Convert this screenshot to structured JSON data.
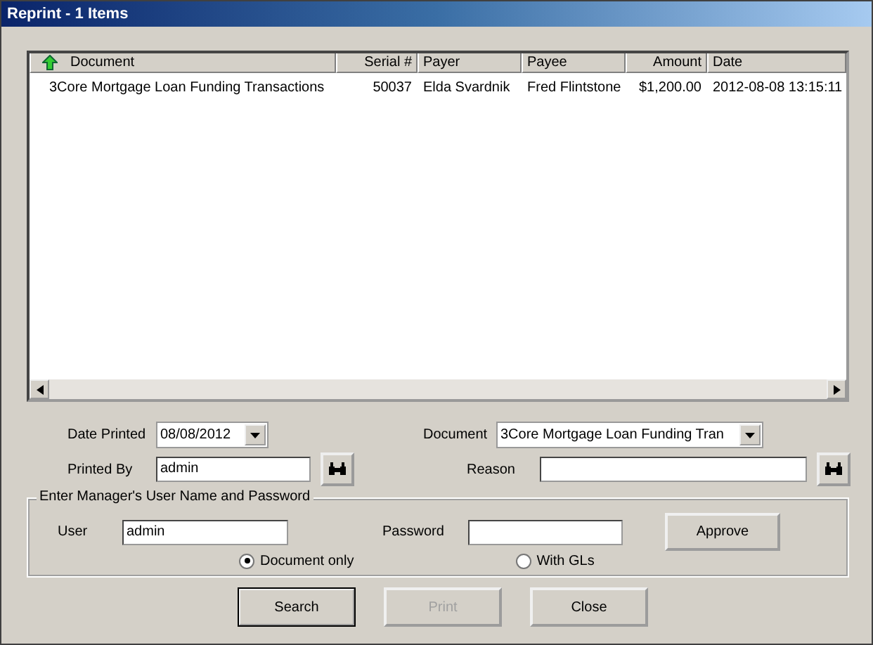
{
  "window": {
    "title": "Reprint - 1 Items"
  },
  "table": {
    "columns": [
      {
        "label": "Document",
        "sorted": true
      },
      {
        "label": "Serial #",
        "sorted": false
      },
      {
        "label": "Payer",
        "sorted": false
      },
      {
        "label": "Payee",
        "sorted": false
      },
      {
        "label": "Amount",
        "sorted": false
      },
      {
        "label": "Date",
        "sorted": false
      }
    ],
    "rows": [
      [
        "3Core Mortgage Loan Funding Transactions",
        "50037",
        "Elda Svardnik",
        "Fred Flintstone",
        "$1,200.00",
        "2012-08-08 13:15:11"
      ]
    ]
  },
  "filters": {
    "date_printed": {
      "label": "Date Printed",
      "value": "08/08/2012"
    },
    "document": {
      "label": "Document",
      "value": "3Core Mortgage Loan Funding Tran"
    },
    "printed_by": {
      "label": "Printed By",
      "value": "admin"
    },
    "reason": {
      "label": "Reason"
    }
  },
  "approval": {
    "title": "Enter Manager's User Name and Password",
    "user": {
      "label": "User",
      "value": "admin"
    },
    "password": {
      "label": "Password"
    },
    "approve": "Approve",
    "options": [
      {
        "label": "Document only",
        "selected": true
      },
      {
        "label": "With GLs",
        "selected": false
      }
    ]
  },
  "buttons": [
    {
      "label": "Search",
      "disabled": false,
      "default": true
    },
    {
      "label": "Print",
      "disabled": true,
      "default": false
    },
    {
      "label": "Close",
      "disabled": false,
      "default": false
    }
  ]
}
